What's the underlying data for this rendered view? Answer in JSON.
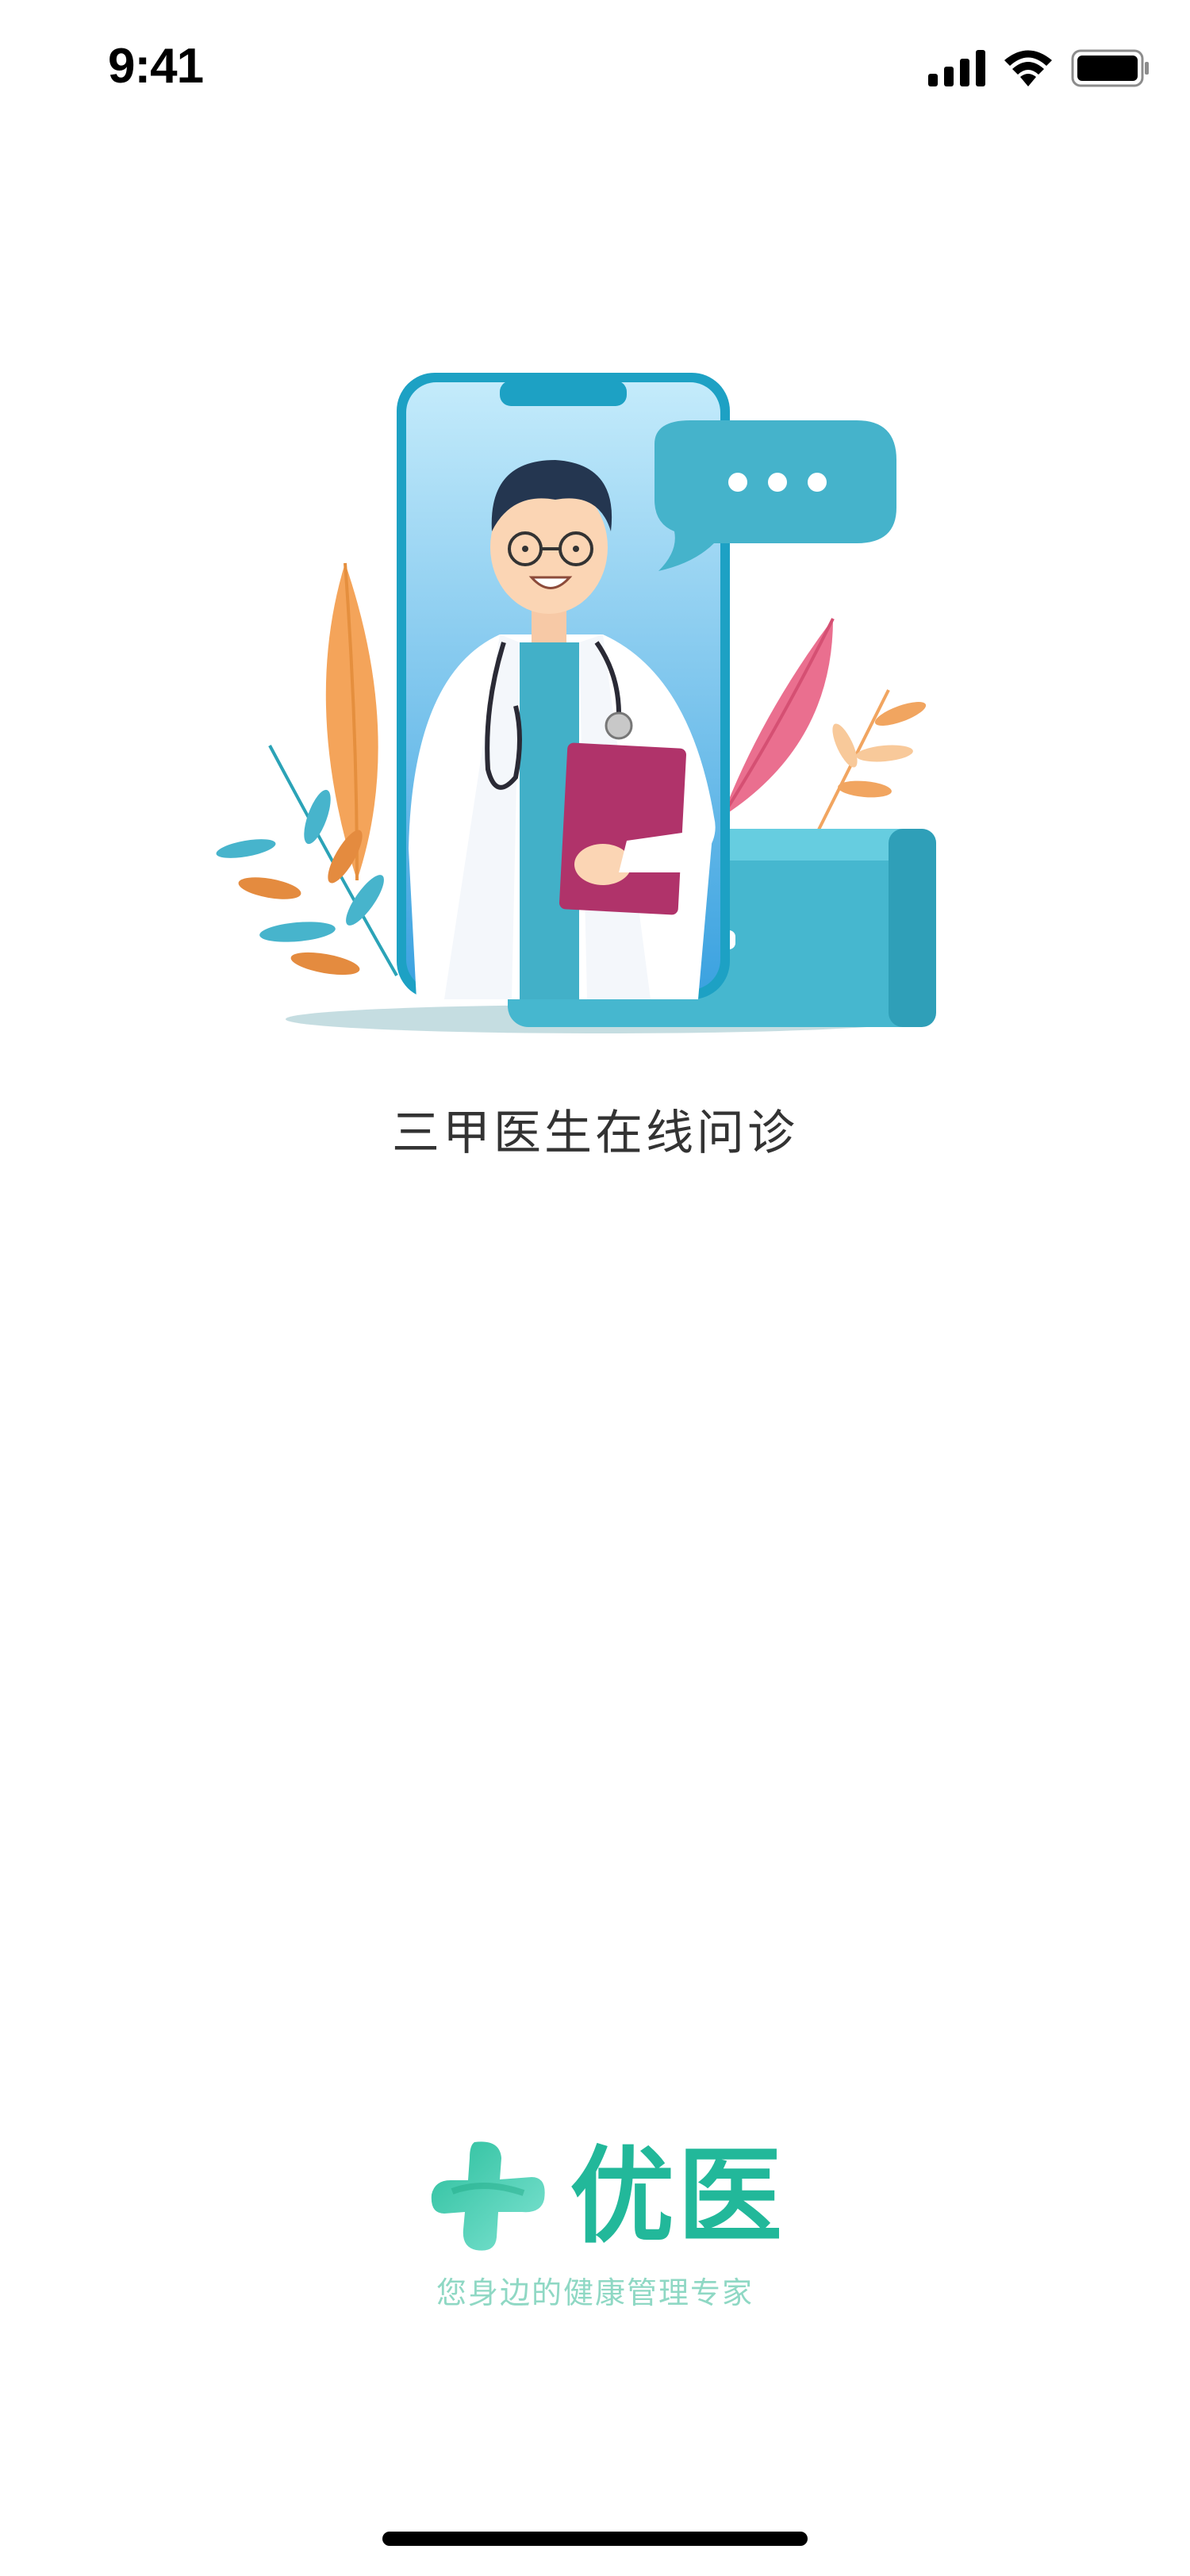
{
  "status_bar": {
    "time": "9:41",
    "icons": [
      "cellular-signal-icon",
      "wifi-icon",
      "battery-icon"
    ]
  },
  "illustration": {
    "subject": "doctor-video-consultation-illustration"
  },
  "tagline": "三甲医生在线问诊",
  "brand": {
    "name": "优医",
    "slogan": "您身边的健康管理专家",
    "primary_color": "#22b89a",
    "slogan_color": "#8fd8c4"
  }
}
